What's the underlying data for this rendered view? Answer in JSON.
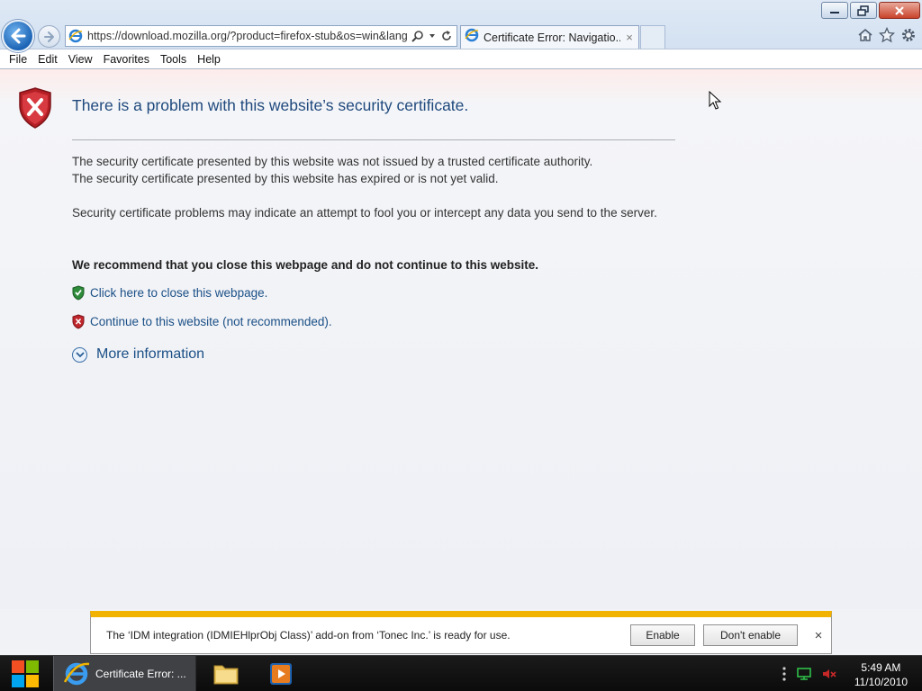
{
  "browser": {
    "address_url": "https://download.mozilla.org/?product=firefox-stub&os=win&lang",
    "tab_title": "Certificate Error: Navigatio...",
    "tab_close": "×",
    "icons": [
      "back-arrow-icon",
      "forward-arrow-icon",
      "ie-logo-icon",
      "search-icon",
      "dropdown-icon",
      "refresh-icon",
      "home-icon",
      "favorites-star-icon",
      "settings-gear-icon"
    ]
  },
  "window_controls": [
    "minimize",
    "restore",
    "close"
  ],
  "menu": [
    "File",
    "Edit",
    "View",
    "Favorites",
    "Tools",
    "Help"
  ],
  "page": {
    "title": "There is a problem with this website’s security certificate.",
    "para1_line1": "The security certificate presented by this website was not issued by a trusted certificate authority.",
    "para1_line2": "The security certificate presented by this website has expired or is not yet valid.",
    "para2": "Security certificate problems may indicate an attempt to fool you or intercept any data you send to the server.",
    "recommend": "We recommend that you close this webpage and do not continue to this website.",
    "close_link": "Click here to close this webpage.",
    "continue_link": "Continue to this website (not recommended).",
    "more_info": "More information"
  },
  "notification": {
    "text": "The ‘IDM integration (IDMIEHlprObj Class)’ add-on from ‘Tonec Inc.’ is ready for use.",
    "enable": "Enable",
    "dont_enable": "Don't enable",
    "close": "×"
  },
  "taskbar": {
    "ie_label": "Certificate Error: ...",
    "time": "5:49 AM",
    "date": "11/10/2010"
  },
  "colors": {
    "link": "#1a4f86",
    "title": "#1f497d",
    "notification_accent": "#f2b300",
    "error_red": "#c0272d",
    "safe_green": "#2e8b3a"
  }
}
